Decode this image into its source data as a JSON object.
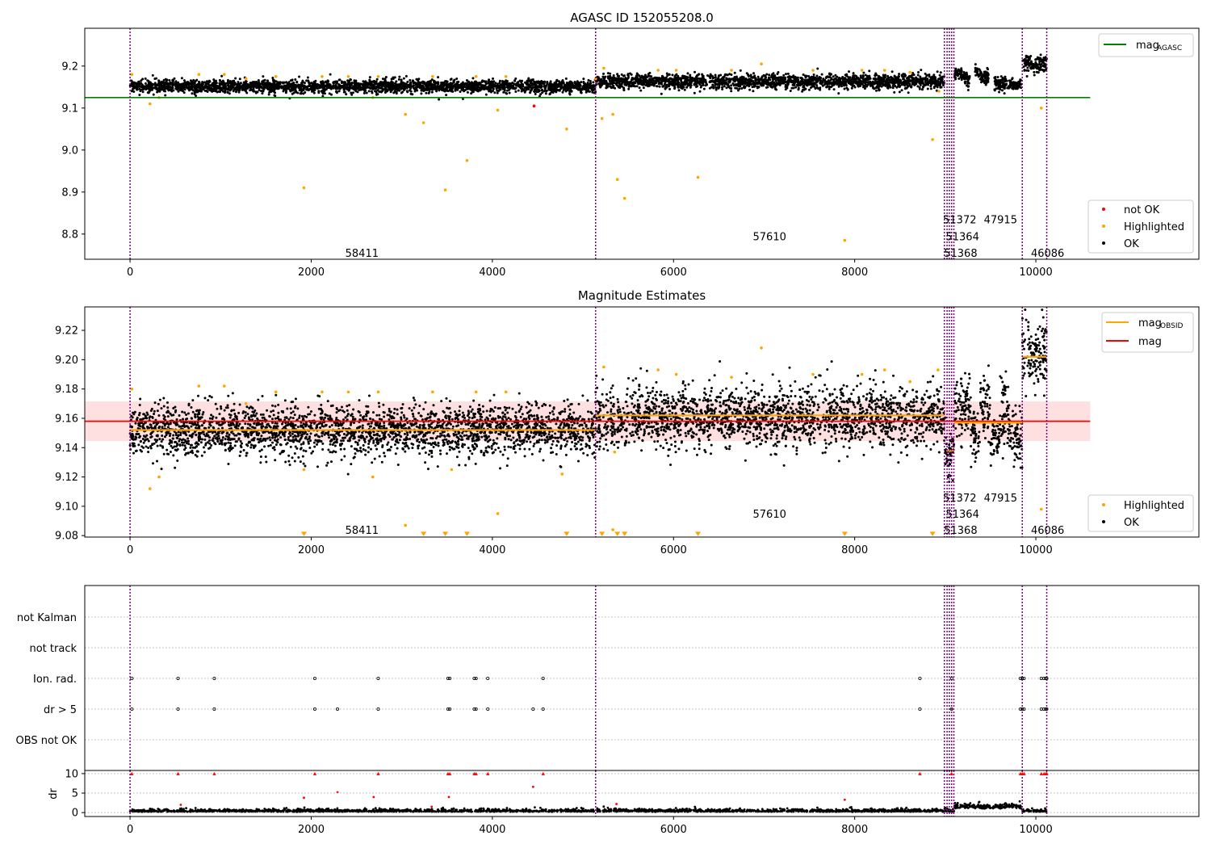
{
  "chart_data": [
    {
      "type": "scatter",
      "title": "AGASC ID 152055208.0",
      "xlim": [
        -500,
        11800
      ],
      "ylim": [
        8.74,
        9.29
      ],
      "xticks": [
        0,
        2000,
        4000,
        6000,
        8000,
        10000
      ],
      "yticks": [
        8.8,
        8.9,
        9.0,
        9.1,
        9.2
      ],
      "ytick_labels": [
        "8.8",
        "8.9",
        "9.0",
        "9.1",
        "9.2"
      ],
      "grid": false,
      "legend_top": {
        "position": "top-right",
        "entries": [
          {
            "label": "mag",
            "sub": "AGASC",
            "color": "#008000"
          }
        ]
      },
      "legend_bottom": {
        "position": "bottom-right",
        "entries": [
          {
            "label": "not OK",
            "color": "#ff0000"
          },
          {
            "label": "Highlighted",
            "color": "#ffa500"
          },
          {
            "label": "OK",
            "color": "#000000"
          }
        ]
      },
      "reference_line": {
        "name": "mag_AGASC",
        "y": 9.125,
        "x": [
          -500,
          10600
        ],
        "color": "#008000"
      },
      "vlines": [
        0,
        5140,
        8990,
        9020,
        9045,
        9070,
        9095,
        9850,
        10120
      ],
      "obsid_labels": [
        {
          "text": "58411",
          "x": 2560,
          "y": 8.755
        },
        {
          "text": "57610",
          "x": 7060,
          "y": 8.795
        },
        {
          "text": "51372",
          "x": 9160,
          "y": 8.835
        },
        {
          "text": "47915",
          "x": 9610,
          "y": 8.835
        },
        {
          "text": "51364",
          "x": 9190,
          "y": 8.795
        },
        {
          "text": "51368",
          "x": 9170,
          "y": 8.755
        },
        {
          "text": "46086",
          "x": 10130,
          "y": 8.755
        }
      ],
      "bands": [
        {
          "x": [
            0,
            5140
          ],
          "mean": 9.152,
          "sd": 0.0075
        },
        {
          "x": [
            5140,
            8990
          ],
          "mean": 9.163,
          "sd": 0.0085
        },
        {
          "x": [
            9100,
            9270
          ],
          "mean": 9.178,
          "sd": 0.008
        },
        {
          "x": [
            9330,
            9480
          ],
          "mean": 9.178,
          "sd": 0.008
        },
        {
          "x": [
            9540,
            9690
          ],
          "mean": 9.155,
          "sd": 0.01
        },
        {
          "x": [
            9700,
            9840
          ],
          "mean": 9.155,
          "sd": 0.006
        },
        {
          "x": [
            9850,
            10120
          ],
          "mean": 9.205,
          "sd": 0.01
        }
      ],
      "highlighted": [
        [
          20,
          9.18
        ],
        [
          220,
          9.11
        ],
        [
          320,
          9.125
        ],
        [
          760,
          9.18
        ],
        [
          1040,
          9.18
        ],
        [
          1280,
          9.17
        ],
        [
          1610,
          9.175
        ],
        [
          1920,
          8.91
        ],
        [
          2120,
          9.175
        ],
        [
          2410,
          9.175
        ],
        [
          2680,
          9.125
        ],
        [
          2740,
          9.175
        ],
        [
          3040,
          9.085
        ],
        [
          3240,
          9.065
        ],
        [
          3340,
          9.175
        ],
        [
          3480,
          8.905
        ],
        [
          3720,
          8.975
        ],
        [
          3820,
          9.175
        ],
        [
          4060,
          9.095
        ],
        [
          4150,
          9.175
        ],
        [
          4820,
          9.05
        ],
        [
          5140,
          9.17
        ],
        [
          5210,
          9.075
        ],
        [
          5230,
          9.195
        ],
        [
          5330,
          9.085
        ],
        [
          5380,
          8.93
        ],
        [
          5460,
          8.885
        ],
        [
          5830,
          9.19
        ],
        [
          6030,
          9.19
        ],
        [
          6270,
          8.935
        ],
        [
          6640,
          9.19
        ],
        [
          6970,
          9.205
        ],
        [
          7540,
          9.19
        ],
        [
          7890,
          8.785
        ],
        [
          8080,
          9.19
        ],
        [
          8330,
          9.19
        ],
        [
          8610,
          9.185
        ],
        [
          8860,
          9.025
        ],
        [
          8930,
          9.14
        ],
        [
          10060,
          9.1
        ]
      ],
      "not_ok": [
        [
          4460,
          9.105
        ]
      ],
      "n_ok_points": 5200
    },
    {
      "type": "scatter",
      "title": "Magnitude Estimates",
      "xlim": [
        -500,
        11800
      ],
      "ylim": [
        9.079,
        9.236
      ],
      "xticks": [
        0,
        2000,
        4000,
        6000,
        8000,
        10000
      ],
      "yticks": [
        9.08,
        9.1,
        9.12,
        9.14,
        9.16,
        9.18,
        9.2,
        9.22
      ],
      "ytick_labels": [
        "9.08",
        "9.10",
        "9.12",
        "9.14",
        "9.16",
        "9.18",
        "9.20",
        "9.22"
      ],
      "grid": false,
      "legend_top": {
        "position": "top-right",
        "entries": [
          {
            "label": "mag",
            "sub": "OBSID",
            "color": "#ffa500"
          },
          {
            "label": "mag",
            "sub": "",
            "color": "#ff0000"
          }
        ]
      },
      "legend_bottom": {
        "position": "bottom-right",
        "entries": [
          {
            "label": "Highlighted",
            "color": "#ffa500"
          },
          {
            "label": "OK",
            "color": "#000000"
          }
        ]
      },
      "reference_line": {
        "name": "mag",
        "y": 9.158,
        "x": [
          -500,
          10600
        ],
        "color": "#ff0000"
      },
      "mag_band": [
        9.1445,
        9.1715
      ],
      "obsid_mag": [
        {
          "x": [
            0,
            5140
          ],
          "y": 9.152
        },
        {
          "x": [
            5140,
            8990
          ],
          "y": 9.162
        },
        {
          "x": [
            9010,
            9100
          ],
          "y": 9.138
        },
        {
          "x": [
            9100,
            9850
          ],
          "y": 9.157
        },
        {
          "x": [
            9850,
            10120
          ],
          "y": 9.202
        }
      ],
      "vlines": [
        0,
        5140,
        8990,
        9020,
        9045,
        9070,
        9095,
        9850,
        10120
      ],
      "obsid_labels": [
        {
          "text": "58411",
          "x": 2560,
          "y": 9.084
        },
        {
          "text": "57610",
          "x": 7060,
          "y": 9.095
        },
        {
          "text": "51372",
          "x": 9160,
          "y": 9.106
        },
        {
          "text": "47915",
          "x": 9610,
          "y": 9.106
        },
        {
          "text": "51364",
          "x": 9190,
          "y": 9.095
        },
        {
          "text": "51368",
          "x": 9170,
          "y": 9.084
        },
        {
          "text": "46086",
          "x": 10130,
          "y": 9.084
        }
      ],
      "highlighted": [
        [
          20,
          9.18
        ],
        [
          220,
          9.112
        ],
        [
          320,
          9.12
        ],
        [
          760,
          9.182
        ],
        [
          1040,
          9.182
        ],
        [
          1280,
          9.17
        ],
        [
          1610,
          9.178
        ],
        [
          1920,
          9.125
        ],
        [
          2120,
          9.178
        ],
        [
          2410,
          9.178
        ],
        [
          2680,
          9.12
        ],
        [
          2740,
          9.178
        ],
        [
          3040,
          9.087
        ],
        [
          3340,
          9.178
        ],
        [
          3550,
          9.125
        ],
        [
          3820,
          9.178
        ],
        [
          4060,
          9.095
        ],
        [
          4150,
          9.178
        ],
        [
          4770,
          9.122
        ],
        [
          5230,
          9.195
        ],
        [
          5330,
          9.084
        ],
        [
          5350,
          9.137
        ],
        [
          5830,
          9.193
        ],
        [
          6030,
          9.19
        ],
        [
          6640,
          9.188
        ],
        [
          6970,
          9.208
        ],
        [
          7540,
          9.19
        ],
        [
          8080,
          9.19
        ],
        [
          8330,
          9.193
        ],
        [
          8610,
          9.185
        ],
        [
          8920,
          9.193
        ],
        [
          10060,
          9.098
        ]
      ],
      "clipped_markers": [
        1920,
        3240,
        3480,
        3720,
        4820,
        5210,
        5380,
        5460,
        6270,
        7890,
        8860
      ],
      "clip_y": 9.081,
      "n_ok_points": 5200
    },
    {
      "type": "scatter",
      "title": "",
      "xlim": [
        -500,
        11800
      ],
      "xticks": [
        0,
        2000,
        4000,
        6000,
        8000,
        10000
      ],
      "flag_rows": [
        "not Kalman",
        "not track",
        "Ion. rad.",
        "dr > 5",
        "OBS not OK"
      ],
      "flags": {
        "Ion. rad.": [
          20,
          530,
          930,
          2040,
          2740,
          3510,
          3530,
          3800,
          3820,
          3950,
          4560,
          8720,
          9070,
          9830,
          9850,
          9870,
          10060,
          10090,
          10110,
          10120
        ],
        "dr > 5": [
          20,
          530,
          930,
          2040,
          2290,
          2740,
          3510,
          3530,
          3800,
          3820,
          3950,
          4450,
          4560,
          8720,
          9070,
          9830,
          9850,
          9870,
          10060,
          10090,
          10110,
          10120
        ]
      },
      "dr": {
        "ylabel": "dr",
        "yticks": [
          0,
          5,
          10
        ],
        "ylim": [
          -1,
          10.8
        ],
        "n_points": 2400,
        "clipped_markers": [
          20,
          530,
          930,
          2040,
          2740,
          3510,
          3530,
          3800,
          3820,
          3950,
          4560,
          8720,
          9070,
          9830,
          9850,
          9870,
          10060,
          10090,
          10110,
          10120
        ],
        "outliers": [
          [
            1920,
            3.8
          ],
          [
            2290,
            5.2
          ],
          [
            2690,
            4.0
          ],
          [
            3520,
            4.0
          ],
          [
            4450,
            6.6
          ],
          [
            7890,
            3.3
          ],
          [
            560,
            2.0
          ],
          [
            5370,
            2.2
          ],
          [
            3330,
            1.5
          ]
        ]
      },
      "vlines": [
        0,
        5140,
        8990,
        9020,
        9045,
        9070,
        9095,
        9850,
        10120
      ]
    }
  ]
}
